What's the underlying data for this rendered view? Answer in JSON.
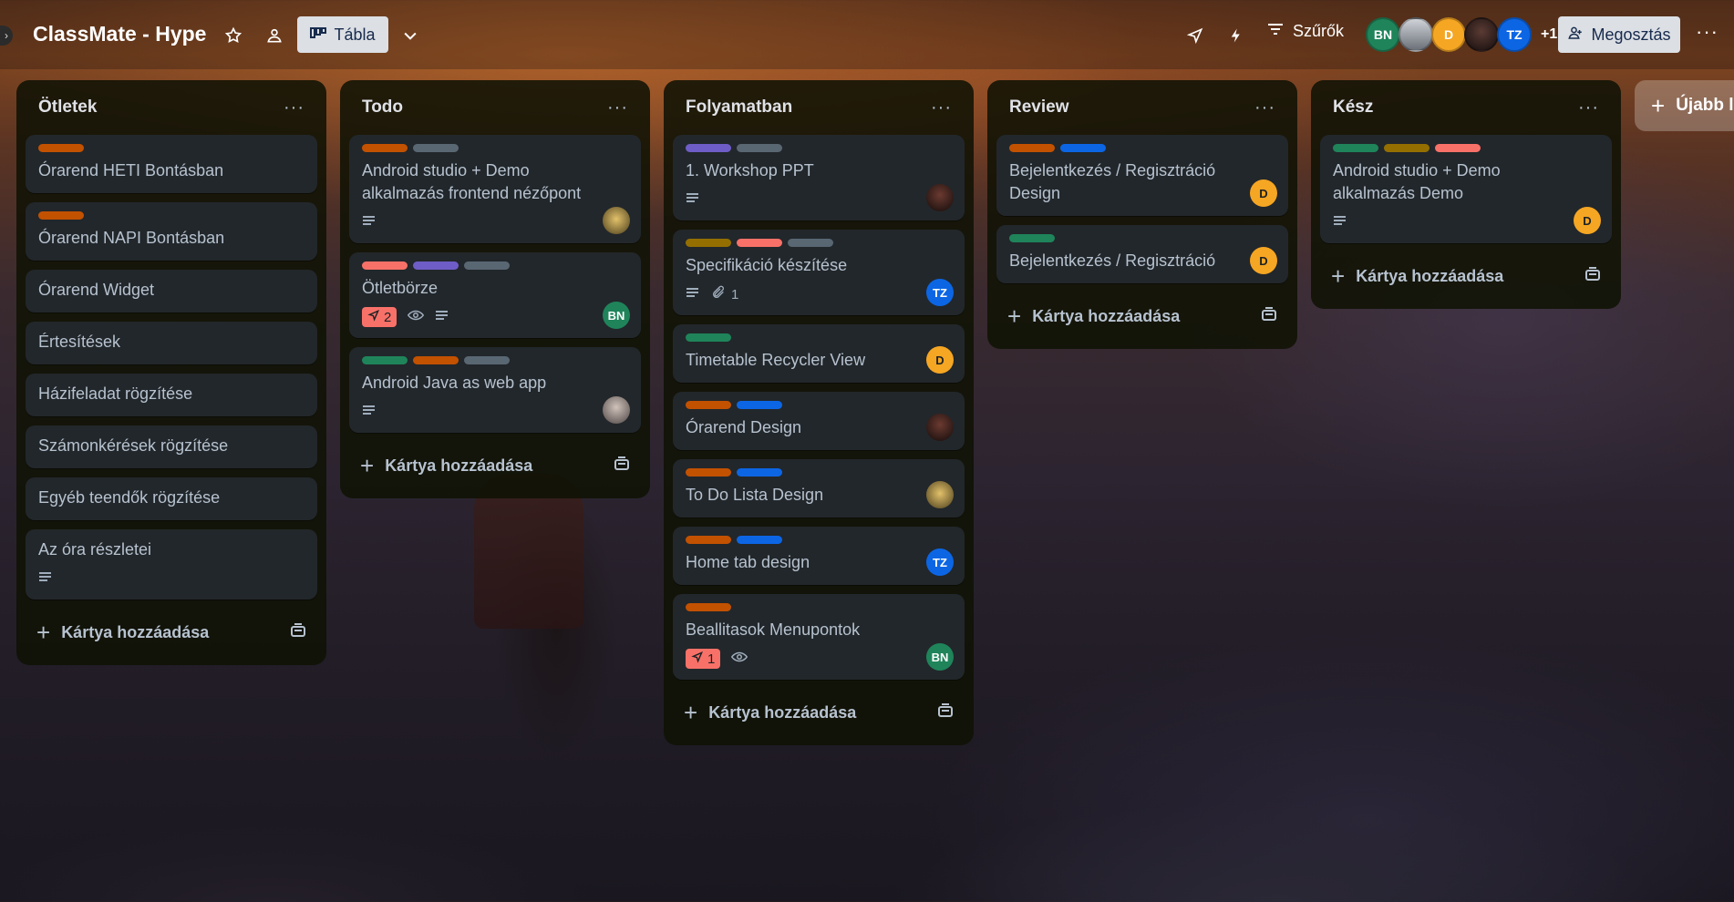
{
  "board": {
    "title": "ClassMate - Hype"
  },
  "header": {
    "view_label": "Tábla",
    "filters_label": "Szűrők",
    "share_label": "Megosztás",
    "members_more": "+1",
    "members": [
      {
        "initials": "BN",
        "color": "#1f845a"
      },
      {
        "initials": "",
        "color": "#8a8f96"
      },
      {
        "initials": "D",
        "color": "#f5a623"
      },
      {
        "initials": "",
        "color": "#2a1a1a"
      },
      {
        "initials": "TZ",
        "color": "#0c66e4"
      }
    ]
  },
  "add_card_label": "Kártya hozzáadása",
  "new_list_label": "Újabb lis",
  "lists": [
    {
      "title": "Ötletek",
      "cards": [
        {
          "title": "Órarend HETI Bontásban",
          "labels": [
            "#c25100"
          ]
        },
        {
          "title": "Órarend NAPI Bontásban",
          "labels": [
            "#c25100"
          ]
        },
        {
          "title": "Órarend Widget"
        },
        {
          "title": "Értesítések"
        },
        {
          "title": "Házifeladat rögzítése"
        },
        {
          "title": "Számonkérések rögzítése"
        },
        {
          "title": "Egyéb teendők rögzítése"
        },
        {
          "title": "Az óra részletei",
          "description": true
        }
      ]
    },
    {
      "title": "Todo",
      "cards": [
        {
          "title": "Android studio + Demo alkalmazás frontend nézőpont",
          "labels": [
            "#c25100",
            "#596773"
          ],
          "description": true,
          "member": "photo-yellow"
        },
        {
          "title": "Ötletbörze",
          "labels": [
            "#f87168",
            "#6e5dc6",
            "#596773"
          ],
          "votes": "2",
          "watch": true,
          "description": true,
          "member": "BN"
        },
        {
          "title": "Android Java as web app",
          "labels": [
            "#1f845a",
            "#c25100",
            "#596773"
          ],
          "description": true,
          "member": "photo-grey"
        }
      ]
    },
    {
      "title": "Folyamatban",
      "cards": [
        {
          "title": "1. Workshop PPT",
          "labels": [
            "#6e5dc6",
            "#596773"
          ],
          "description": true,
          "member": "photo-dark"
        },
        {
          "title": "Specifikáció készítése",
          "labels": [
            "#946f00",
            "#f87168",
            "#596773"
          ],
          "description": true,
          "attachments": "1",
          "member": "TZ"
        },
        {
          "title": "Timetable Recycler View",
          "labels": [
            "#1f845a"
          ],
          "member": "D"
        },
        {
          "title": "Órarend Design",
          "labels": [
            "#c25100",
            "#0c66e4"
          ],
          "member": "photo-dark"
        },
        {
          "title": "To Do Lista Design",
          "labels": [
            "#c25100",
            "#0c66e4"
          ],
          "member": "photo-yellow"
        },
        {
          "title": "Home tab design",
          "labels": [
            "#c25100",
            "#0c66e4"
          ],
          "member": "TZ"
        },
        {
          "title": "Beallitasok Menupontok",
          "labels": [
            "#c25100"
          ],
          "votes": "1",
          "watch": true,
          "member": "BN"
        }
      ]
    },
    {
      "title": "Review",
      "cards": [
        {
          "title": "Bejelentkezés / Regisztráció Design",
          "labels": [
            "#c25100",
            "#0c66e4"
          ],
          "member": "D"
        },
        {
          "title": "Bejelentkezés / Regisztráció",
          "labels": [
            "#1f845a"
          ],
          "member": "D"
        }
      ]
    },
    {
      "title": "Kész",
      "cards": [
        {
          "title": "Android studio + Demo alkalmazás Demo",
          "labels": [
            "#1f845a",
            "#946f00",
            "#f87168"
          ],
          "description": true,
          "member": "D"
        }
      ]
    }
  ]
}
